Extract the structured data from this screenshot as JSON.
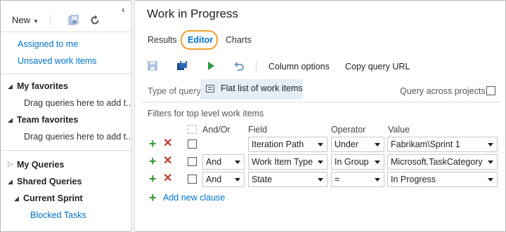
{
  "sidebar": {
    "new_label": "New",
    "links": [
      "Assigned to me",
      "Unsaved work items"
    ],
    "my_favorites": {
      "label": "My favorites",
      "hint": "Drag queries here to add t..."
    },
    "team_favorites": {
      "label": "Team favorites",
      "hint": "Drag queries here to add t..."
    },
    "my_queries": "My Queries",
    "shared_queries": "Shared Queries",
    "current_sprint": "Current Sprint",
    "blocked_tasks": "Blocked Tasks"
  },
  "main": {
    "title": "Work in Progress",
    "tabs": [
      "Results",
      "Editor",
      "Charts"
    ],
    "active_tab": "Editor",
    "toolbar": {
      "column_options": "Column options",
      "copy_query_url": "Copy query URL"
    },
    "type_of_query_label": "Type of query",
    "type_of_query_value": "Flat list of work items",
    "query_across_projects": "Query across projects",
    "filters_label": "Filters for top level work items",
    "columns": {
      "and_or": "And/Or",
      "field": "Field",
      "operator": "Operator",
      "value": "Value"
    },
    "clauses": [
      {
        "and_or": "",
        "field": "Iteration Path",
        "operator": "Under",
        "value": "Fabrikam\\Sprint 1"
      },
      {
        "and_or": "And",
        "field": "Work Item Type",
        "operator": "In Group",
        "value": "Microsoft.TaskCategory"
      },
      {
        "and_or": "And",
        "field": "State",
        "operator": "=",
        "value": "In Progress"
      }
    ],
    "add_new_clause": "Add new clause"
  },
  "colors": {
    "link": "#0072c6",
    "add_green": "#339933",
    "delete_red": "#c0392b",
    "highlight_ring": "#f0a030",
    "selection_bg": "#e5eef7"
  }
}
